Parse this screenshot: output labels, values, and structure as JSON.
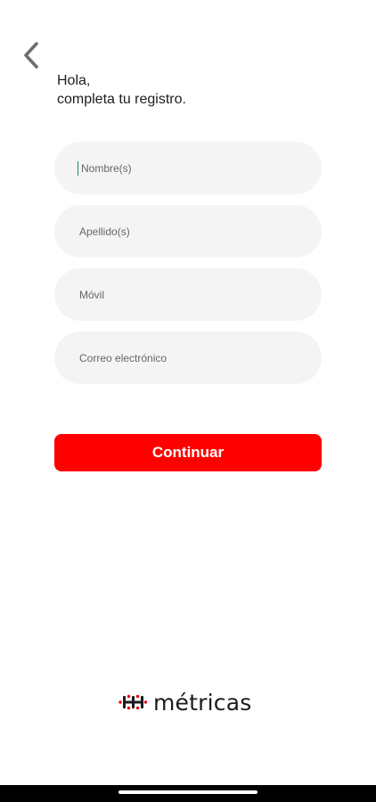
{
  "header": {
    "back_icon": "chevron-left-icon",
    "greeting_line1": "Hola,",
    "greeting_line2": "completa tu registro."
  },
  "form": {
    "first_name": {
      "placeholder": "Nombre(s)",
      "value": "",
      "focused": true
    },
    "last_name": {
      "placeholder": "Apellido(s)",
      "value": ""
    },
    "mobile": {
      "placeholder": "Móvil",
      "value": ""
    },
    "email": {
      "placeholder": "Correo electrónico",
      "value": ""
    }
  },
  "actions": {
    "continue_label": "Continuar"
  },
  "brand": {
    "name": "métricas",
    "logo_icon": "metricas-logo-icon"
  },
  "colors": {
    "accent": "#ff0000",
    "field_bg": "#f4f4f4",
    "text": "#1d1d1d",
    "cursor": "#1a8a6b"
  }
}
